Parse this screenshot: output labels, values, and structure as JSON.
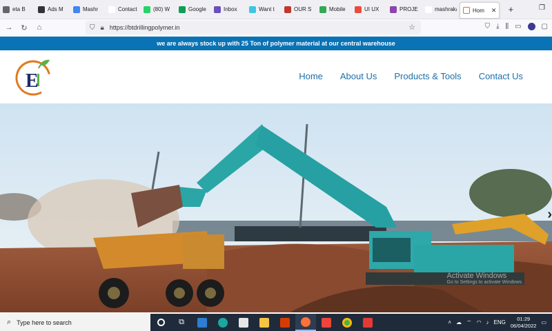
{
  "browser": {
    "tabs": [
      {
        "label": "eta B",
        "color": "#666"
      },
      {
        "label": "Ads M",
        "color": "#333"
      },
      {
        "label": "Mashr",
        "color": "#4285f4"
      },
      {
        "label": "Contact",
        "color": "#fff"
      },
      {
        "label": "(80) W",
        "color": "#25d366"
      },
      {
        "label": "Google",
        "color": "#0f9d58"
      },
      {
        "label": "Inbox",
        "color": "#6b4fbb"
      },
      {
        "label": "Want t",
        "color": "#3ec6e0"
      },
      {
        "label": "OUR S",
        "color": "#c0392b"
      },
      {
        "label": "Mobile",
        "color": "#34a853"
      },
      {
        "label": "UI UX",
        "color": "#e74c3c"
      },
      {
        "label": "PROJE",
        "color": "#8e44ad"
      },
      {
        "label": "mashrakay",
        "color": "#fff"
      }
    ],
    "active_tab": {
      "label": "Hom",
      "close": "✕"
    },
    "new_tab": "+",
    "restore": "❐",
    "url": "https://btdrillingpolymer.in",
    "accent": "#0a73b5"
  },
  "site": {
    "announcement": "we are always stock up with 25 Ton of polymer material at our central warehouse",
    "logo_letter": "E",
    "nav": {
      "home": "Home",
      "about": "About Us",
      "products": "Products & Tools",
      "contact": "Contact Us"
    },
    "next_arrow": "›",
    "watermark_title": "Activate Windows",
    "watermark_sub": "Go to Settings to activate Windows."
  },
  "taskbar": {
    "search_placeholder": "Type here to search",
    "lang": "ENG",
    "time": "01:29",
    "date": "06/04/2022"
  }
}
